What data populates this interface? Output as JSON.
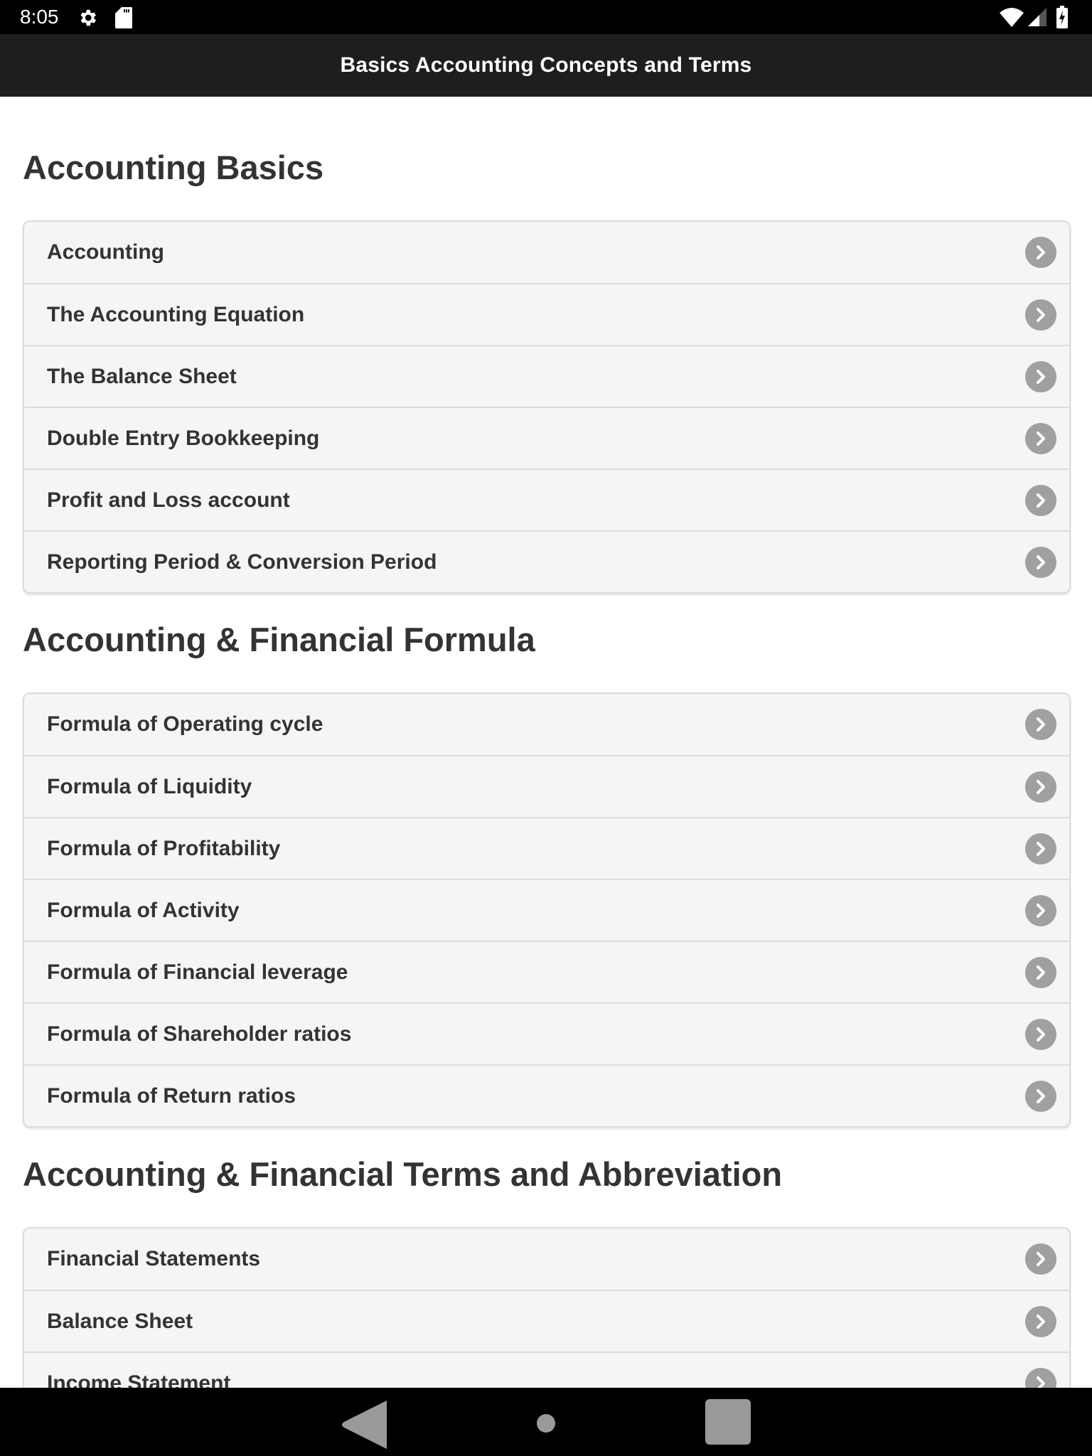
{
  "status_bar": {
    "time": "8:05",
    "left_icons": [
      "settings-icon",
      "sd-card-icon"
    ],
    "right_icons": [
      "wifi-icon",
      "cell-signal-icon",
      "battery-charging-icon"
    ]
  },
  "app_bar": {
    "title": "Basics Accounting Concepts and Terms"
  },
  "sections": [
    {
      "title": "Accounting Basics",
      "items": [
        {
          "label": "Accounting"
        },
        {
          "label": "The Accounting Equation"
        },
        {
          "label": "The Balance Sheet"
        },
        {
          "label": "Double Entry Bookkeeping"
        },
        {
          "label": "Profit and Loss account"
        },
        {
          "label": "Reporting Period & Conversion Period"
        }
      ]
    },
    {
      "title": "Accounting & Financial Formula",
      "items": [
        {
          "label": "Formula of Operating cycle"
        },
        {
          "label": "Formula of Liquidity"
        },
        {
          "label": "Formula of Profitability"
        },
        {
          "label": "Formula of Activity"
        },
        {
          "label": "Formula of Financial leverage"
        },
        {
          "label": "Formula of Shareholder ratios"
        },
        {
          "label": "Formula of Return ratios"
        }
      ]
    },
    {
      "title": "Accounting & Financial Terms and Abbreviation",
      "items": [
        {
          "label": "Financial Statements"
        },
        {
          "label": "Balance Sheet"
        },
        {
          "label": "Income Statement"
        }
      ]
    }
  ],
  "nav_bar": {
    "buttons": [
      "back",
      "home",
      "recents"
    ]
  },
  "colors": {
    "app_bar_bg": "#1e1e1e",
    "list_bg": "#f5f5f5",
    "chevron_bg": "#a0a0a0",
    "text": "#333333"
  }
}
